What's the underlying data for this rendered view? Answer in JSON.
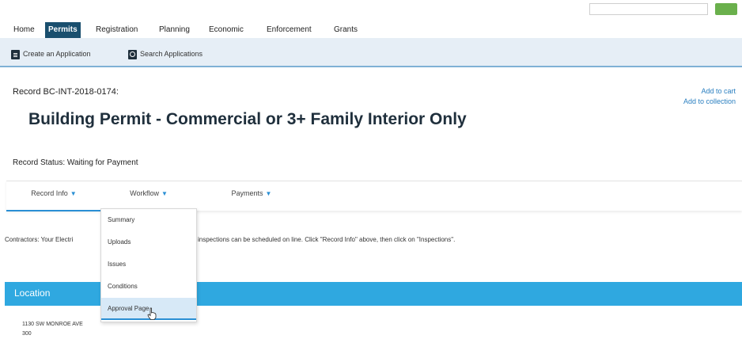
{
  "topbar": {
    "search_placeholder": "",
    "search_button": ""
  },
  "nav": {
    "tabs": [
      {
        "label": "Home"
      },
      {
        "label": "Permits"
      },
      {
        "label": "Registration"
      },
      {
        "label": "Planning"
      },
      {
        "label": "Economic"
      },
      {
        "label": "Enforcement"
      },
      {
        "label": "Grants"
      }
    ],
    "active": "Permits",
    "active_color": "#1a4f6e"
  },
  "subnav": {
    "create_label": "Create an Application",
    "search_label": "Search Applications"
  },
  "record": {
    "id_label": "Record BC-INT-2018-0174:",
    "add_cart": "Add to cart",
    "add_collection": "Add to collection",
    "title": "Building Permit - Commercial or 3+ Family Interior Only",
    "status": "Record Status: Waiting for Payment"
  },
  "record_tabs": [
    {
      "label": "Record Info"
    },
    {
      "label": "Workflow"
    },
    {
      "label": "Payments"
    }
  ],
  "dropdown": {
    "items": [
      {
        "label": "Summary"
      },
      {
        "label": "Uploads"
      },
      {
        "label": "Issues"
      },
      {
        "label": "Conditions"
      },
      {
        "label": "Approval Page"
      }
    ],
    "hovered": "Approval Page"
  },
  "notice": {
    "part1": "Contractors: Your Electri",
    "part2": "inspections can be scheduled on line. Click \"Record Info\" above, then click on \"Inspections\"."
  },
  "location": {
    "title": "Location",
    "address_line1": "1130 SW MONROE AVE",
    "address_line2": "300"
  },
  "colors": {
    "accent": "#2fa8e0",
    "link": "#2a7fc0",
    "subnav_bg": "#e6eef6"
  }
}
